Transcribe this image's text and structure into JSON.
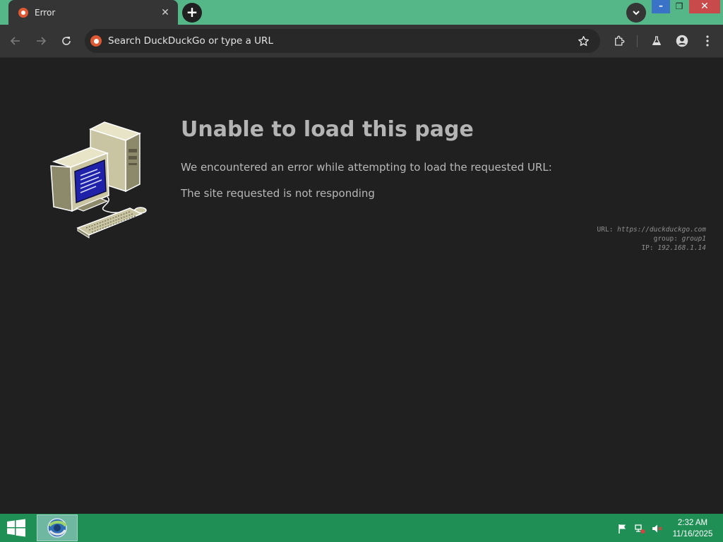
{
  "browser": {
    "tab": {
      "title": "Error",
      "close_glyph": "✕"
    },
    "new_tab_glyph": "+",
    "window_controls": {
      "minimize": "–",
      "maximize": "❐",
      "close": "✕"
    },
    "omnibox": {
      "placeholder": "Search DuckDuckGo or type a URL",
      "value": ""
    }
  },
  "page": {
    "title": "Unable to load this page",
    "message": "We encountered an error while attempting to load the requested URL:",
    "reason": "The site requested is not responding",
    "meta": {
      "url_label": "URL:",
      "url": "https://duckduckgo.com",
      "group_label": "group:",
      "group": "group1",
      "ip_label": "IP:",
      "ip": "192.168.1.14"
    }
  },
  "taskbar": {
    "time": "2:32 AM",
    "date": "11/16/2025"
  },
  "colors": {
    "tab_strip": "#55b787",
    "toolbar": "#353535",
    "content_bg": "#202020",
    "taskbar": "#1f8f55",
    "brand": "#de5833"
  },
  "icons": [
    "duckduckgo-favicon-icon",
    "back-arrow-icon",
    "forward-arrow-icon",
    "reload-icon",
    "star-icon",
    "extensions-icon",
    "labs-flask-icon",
    "profile-icon",
    "kebab-menu-icon",
    "chevron-down-icon",
    "windows-logo-icon",
    "flag-icon",
    "network-icon",
    "speaker-muted-icon"
  ]
}
